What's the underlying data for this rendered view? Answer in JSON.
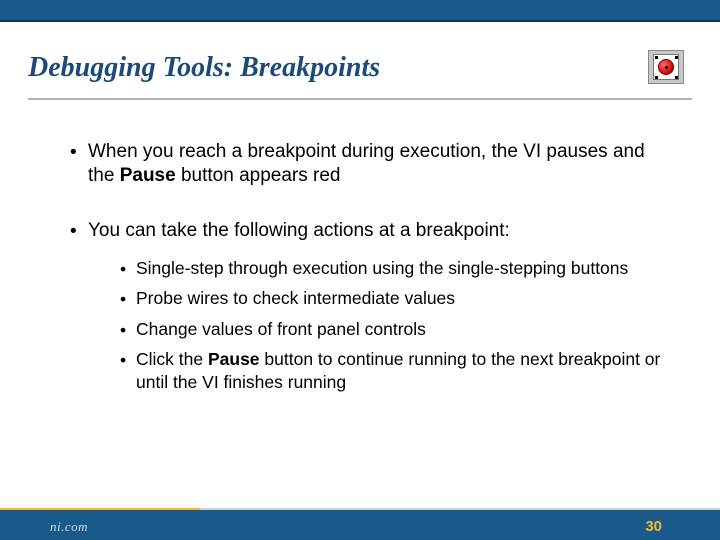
{
  "title": "Debugging Tools: Breakpoints",
  "bullets": {
    "b1_pre": "When you reach a breakpoint during execution, the VI pauses and the ",
    "b1_bold": "Pause",
    "b1_post": " button appears red",
    "b2": "You can take the following actions at a breakpoint:",
    "sub1": "Single-step through execution using the single-stepping buttons",
    "sub2": "Probe wires to check intermediate values",
    "sub3": "Change values of front panel controls",
    "sub4_pre": "Click the ",
    "sub4_bold": "Pause",
    "sub4_post": " button to continue running to the next breakpoint or until the VI finishes running"
  },
  "footer": {
    "logo": "ni.com",
    "page": "30"
  }
}
